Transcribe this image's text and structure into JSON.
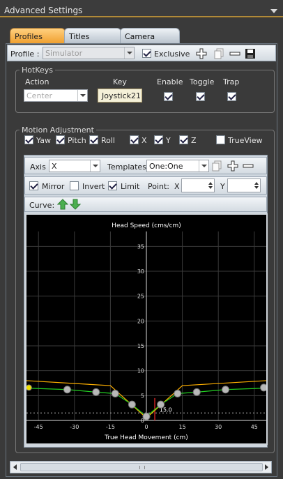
{
  "window": {
    "title": "Advanced Settings"
  },
  "tabs": [
    {
      "label": "Profiles",
      "active": true
    },
    {
      "label": "Titles",
      "active": false
    },
    {
      "label": "Camera",
      "active": false
    }
  ],
  "profile_bar": {
    "profile_label": "Profile :",
    "profile_value": "Simulator",
    "exclusive_label": "Exclusive",
    "exclusive_checked": true
  },
  "hotkeys": {
    "group_title": "HotKeys",
    "headers": {
      "action": "Action",
      "key": "Key",
      "enable": "Enable",
      "toggle": "Toggle",
      "trap": "Trap"
    },
    "action_value": "Center",
    "key_value": "Joystick21",
    "enable": true,
    "toggle": true,
    "trap": true
  },
  "motion": {
    "group_title": "Motion Adjustment",
    "axes": [
      {
        "label": "Yaw",
        "checked": true
      },
      {
        "label": "Pitch",
        "checked": true
      },
      {
        "label": "Roll",
        "checked": true
      },
      {
        "label": "X",
        "checked": true
      },
      {
        "label": "Y",
        "checked": true
      },
      {
        "label": "Z",
        "checked": true
      }
    ],
    "trueview_label": "TrueView",
    "trueview_checked": false
  },
  "curve_toolbar": {
    "axis_label": "Axis",
    "axis_value": "X",
    "templates_label": "Templates",
    "templates_value": "One:One",
    "mirror_label": "Mirror",
    "mirror_checked": true,
    "invert_label": "Invert",
    "invert_checked": false,
    "limit_label": "Limit",
    "limit_checked": true,
    "point_label": "Point:",
    "x_label": "X",
    "y_label": "Y",
    "curve_label": "Curve:"
  },
  "chart_data": {
    "type": "line",
    "title": "Head Speed (cms/cm)",
    "xlabel": "True Head Movement (cm)",
    "ylabel": "",
    "xlim": [
      -50,
      50
    ],
    "ylim": [
      0,
      38
    ],
    "xticks": [
      -45,
      -30,
      -15,
      0,
      15,
      30,
      45
    ],
    "yticks": [
      0,
      5,
      10,
      15,
      20,
      25,
      30,
      35
    ],
    "marker_label": "15.0",
    "limit_value": 1.5,
    "series": [
      {
        "color": "#ffb000",
        "x": [
          -50,
          -15,
          0,
          15,
          50
        ],
        "y": [
          8.0,
          7.0,
          0.5,
          7.0,
          8.0
        ]
      },
      {
        "color": "#22cc22",
        "x": [
          -50,
          -33,
          -21,
          -13,
          -6,
          0,
          6,
          13,
          21,
          33,
          50
        ],
        "y": [
          6.5,
          6.2,
          5.7,
          5.4,
          3.2,
          0.8,
          3.2,
          5.4,
          5.7,
          6.2,
          6.5
        ]
      }
    ],
    "points": {
      "x": [
        -49,
        -33,
        -21,
        -13,
        -6,
        0,
        6,
        13,
        21,
        33,
        49
      ],
      "y": [
        6.6,
        6.2,
        5.7,
        5.4,
        3.2,
        0.8,
        3.2,
        5.4,
        5.7,
        6.2,
        6.6
      ]
    },
    "grid": true
  },
  "colors": {
    "accent": "#f0a030",
    "chart_bg": "#000000",
    "grid": "#3a3a3a",
    "marker_line": "#cc2222"
  }
}
